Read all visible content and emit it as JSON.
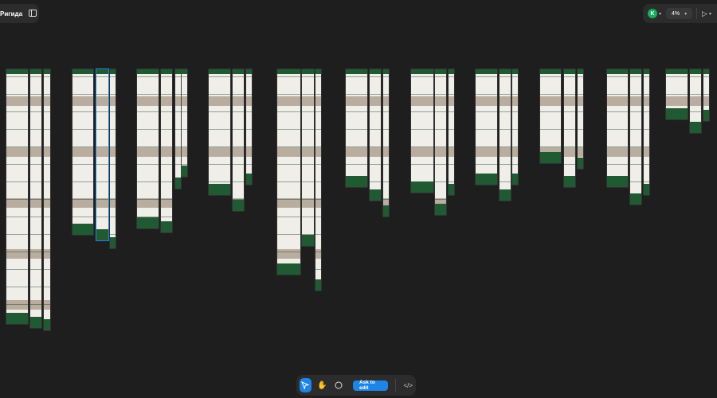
{
  "header": {
    "file_title": "Ригида",
    "avatar_letter": "K",
    "zoom_level": "4%"
  },
  "toolbar": {
    "ask_to_edit_label": "Ask to edit",
    "code_label": "</>"
  },
  "colors": {
    "background": "#1e1e1e",
    "panel": "#2c2c2c",
    "accent": "#1d85e6",
    "avatar": "#14ae5c",
    "frame_green": "#1f5a32"
  },
  "icons": [
    "sidebar-toggle-icon",
    "chevron-down-icon",
    "play-icon",
    "move-cursor-icon",
    "hand-tool-icon",
    "comment-icon",
    "code-icon"
  ]
}
